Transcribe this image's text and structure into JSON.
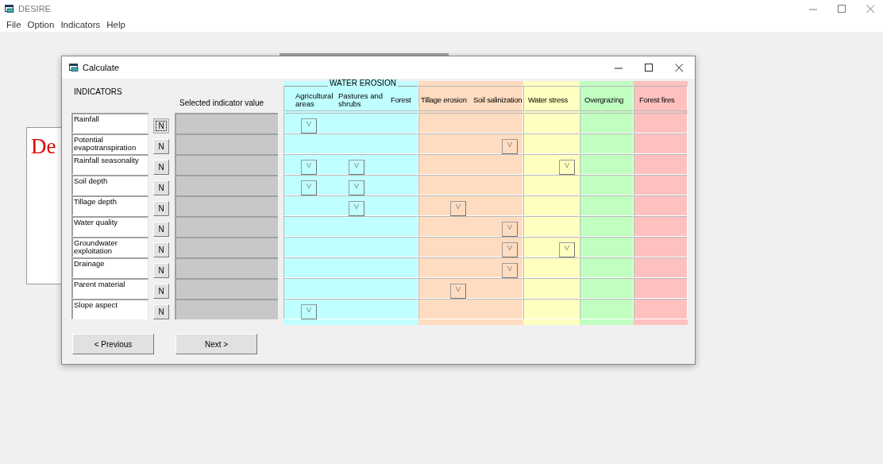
{
  "app": {
    "title": "DESIRE",
    "menu": [
      "File",
      "Option",
      "Indicators",
      "Help"
    ]
  },
  "background_document": {
    "text": "De"
  },
  "dialog": {
    "title": "Calculate",
    "indicators_heading": "INDICATORS",
    "value_heading": "Selected indicator value",
    "groups": [
      {
        "title": "WATER EROSION",
        "color": "#c0ffff",
        "columns": [
          "Agricultural areas",
          "Pastures and shrubs",
          "Forest"
        ]
      },
      {
        "color": "#ffdcc0",
        "columns": [
          "Tillage erosion",
          "Soil salinization"
        ]
      },
      {
        "color": "#ffffc0",
        "columns": [
          "Water stress"
        ]
      },
      {
        "color": "#c0ffc0",
        "columns": [
          "Overgrazing"
        ]
      },
      {
        "color": "#ffc0c0",
        "columns": [
          "Forest fires"
        ]
      }
    ],
    "rows": [
      {
        "indicator": "Rainfall",
        "button": "N",
        "focused": true,
        "cells": [
          {
            "kind": "v",
            "label": "V"
          },
          {
            "kind": "blank"
          },
          {
            "kind": "blank"
          },
          {
            "kind": "blank"
          },
          {
            "kind": "blank"
          },
          {
            "kind": "blank"
          },
          {
            "kind": "blank"
          },
          {
            "kind": "blank"
          }
        ]
      },
      {
        "indicator": "Potential evapotranspiration",
        "button": "N",
        "focused": false,
        "cells": [
          {
            "kind": "blank"
          },
          {
            "kind": "blank"
          },
          {
            "kind": "blank"
          },
          {
            "kind": "blank"
          },
          {
            "kind": "v",
            "label": "V"
          },
          {
            "kind": "blank"
          },
          {
            "kind": "blank"
          },
          {
            "kind": "blank"
          }
        ]
      },
      {
        "indicator": "Rainfall seasonality",
        "button": "N",
        "focused": false,
        "cells": [
          {
            "kind": "v",
            "label": "V"
          },
          {
            "kind": "v",
            "label": "V"
          },
          {
            "kind": "blank"
          },
          {
            "kind": "blank"
          },
          {
            "kind": "blank"
          },
          {
            "kind": "v",
            "label": "V"
          },
          {
            "kind": "blank"
          },
          {
            "kind": "blank"
          }
        ]
      },
      {
        "indicator": "Soil depth",
        "button": "N",
        "focused": false,
        "cells": [
          {
            "kind": "v",
            "label": "V"
          },
          {
            "kind": "v",
            "label": "V"
          },
          {
            "kind": "blank"
          },
          {
            "kind": "blank"
          },
          {
            "kind": "blank"
          },
          {
            "kind": "blank"
          },
          {
            "kind": "blank"
          },
          {
            "kind": "blank"
          }
        ]
      },
      {
        "indicator": "Tillage depth",
        "button": "N",
        "focused": false,
        "cells": [
          {
            "kind": "blank"
          },
          {
            "kind": "v",
            "label": "V"
          },
          {
            "kind": "blank"
          },
          {
            "kind": "v",
            "label": "V"
          },
          {
            "kind": "blank"
          },
          {
            "kind": "blank"
          },
          {
            "kind": "blank"
          },
          {
            "kind": "blank"
          }
        ]
      },
      {
        "indicator": "Water quality",
        "button": "N",
        "focused": false,
        "cells": [
          {
            "kind": "blank"
          },
          {
            "kind": "blank"
          },
          {
            "kind": "blank"
          },
          {
            "kind": "blank"
          },
          {
            "kind": "v",
            "label": "V"
          },
          {
            "kind": "blank"
          },
          {
            "kind": "blank"
          },
          {
            "kind": "blank"
          }
        ]
      },
      {
        "indicator": "Groundwater exploitation",
        "button": "N",
        "focused": false,
        "cells": [
          {
            "kind": "blank"
          },
          {
            "kind": "blank"
          },
          {
            "kind": "blank"
          },
          {
            "kind": "blank"
          },
          {
            "kind": "v",
            "label": "V"
          },
          {
            "kind": "v",
            "label": "V"
          },
          {
            "kind": "blank"
          },
          {
            "kind": "blank"
          }
        ]
      },
      {
        "indicator": "Drainage",
        "button": "N",
        "focused": false,
        "cells": [
          {
            "kind": "blank"
          },
          {
            "kind": "blank"
          },
          {
            "kind": "blank"
          },
          {
            "kind": "blank"
          },
          {
            "kind": "v",
            "label": "V"
          },
          {
            "kind": "blank"
          },
          {
            "kind": "blank"
          },
          {
            "kind": "blank"
          }
        ]
      },
      {
        "indicator": "Parent material",
        "button": "N",
        "focused": false,
        "cells": [
          {
            "kind": "blank"
          },
          {
            "kind": "blank"
          },
          {
            "kind": "blank"
          },
          {
            "kind": "v",
            "label": "V"
          },
          {
            "kind": "blank"
          },
          {
            "kind": "blank"
          },
          {
            "kind": "blank"
          },
          {
            "kind": "blank"
          }
        ]
      },
      {
        "indicator": "Slope aspect",
        "button": "N",
        "focused": false,
        "cells": [
          {
            "kind": "v",
            "label": "V"
          },
          {
            "kind": "blank"
          },
          {
            "kind": "blank"
          },
          {
            "kind": "blank"
          },
          {
            "kind": "blank"
          },
          {
            "kind": "blank"
          },
          {
            "kind": "blank"
          },
          {
            "kind": "blank"
          }
        ]
      }
    ],
    "buttons": [
      "< Previous",
      "Next >"
    ]
  }
}
